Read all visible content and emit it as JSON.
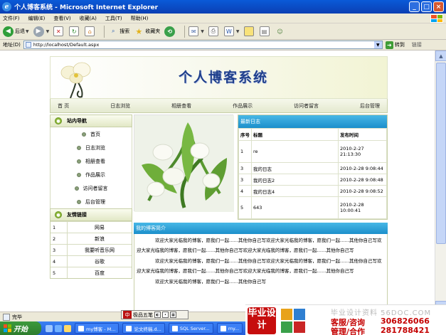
{
  "window": {
    "title": "个人博客系统 - Microsoft Internet Explorer",
    "controls": [
      "_",
      "□",
      "×"
    ]
  },
  "menubar": {
    "items": [
      "文件(F)",
      "编辑(E)",
      "查看(V)",
      "收藏(A)",
      "工具(T)",
      "帮助(H)"
    ]
  },
  "toolbar": {
    "back": "后退",
    "search": "搜索",
    "favorites": "收藏夹"
  },
  "address": {
    "label": "地址(D)",
    "url": "http://localhost/Default.aspx",
    "go": "转到",
    "links": "链接"
  },
  "site": {
    "title": "个人博客系统",
    "nav": [
      "首 页",
      "日志浏览",
      "相册查看",
      "作品展示",
      "访问者留言",
      "后台管理"
    ],
    "sidebar": {
      "nav_title": "站内导航",
      "nav_items": [
        "首页",
        "日志浏览",
        "相册查看",
        "作品展示",
        "访问者留言",
        "后台管理"
      ],
      "links_title": "友情链接",
      "links": [
        {
          "num": "1",
          "name": "网易"
        },
        {
          "num": "2",
          "name": "新浪"
        },
        {
          "num": "3",
          "name": "我要听音乐网"
        },
        {
          "num": "4",
          "name": "谷歌"
        },
        {
          "num": "5",
          "name": "百度"
        }
      ]
    },
    "diary": {
      "title": "最新日志",
      "headers": {
        "num": "序号",
        "title": "标题",
        "time": "发布时间"
      },
      "rows": [
        {
          "num": "1",
          "title": "re",
          "time": "2010-2-27 21:13:30"
        },
        {
          "num": "3",
          "title": "我的日志",
          "time": "2010-2-28 9:08:44"
        },
        {
          "num": "3",
          "title": "我的日志2",
          "time": "2010-2-28 9:08:48"
        },
        {
          "num": "4",
          "title": "我的日志4",
          "time": "2010-2-28 9:08:52"
        },
        {
          "num": "5",
          "title": "643",
          "time": "2010-2-28 10:00:41"
        }
      ]
    },
    "intro": {
      "title": "我的博客简介",
      "paragraphs": [
        "欢迎大家光临我的博客，愿我们一起……其他你自己写欢迎大家光临我的博客，愿我们一起……其他你自己写欢迎大家光临我的博客，愿我们一起……其他你自己写欢迎大家光临我的博客，愿我们一起……其他你自己写",
        "欢迎大家光临我的博客，愿我们一起……其他你自己写欢迎大家光临我的博客，愿我们一起……其他你自己写欢迎大家光临我的博客，愿我们一起……其他你自己写欢迎大家光临我的博客，愿我们一起……其他你自己写",
        "欢迎大家光临我的博客，愿我们一起……其他你自己写"
      ]
    }
  },
  "status": {
    "text": "完毕",
    "ime": "极品五笔"
  },
  "taskbar": {
    "start": "开始",
    "tasks": [
      "my博客 - M...",
      "论文终稿.d...",
      "SQL Server...",
      "my..."
    ]
  },
  "ad": {
    "logo_text": "毕业设计",
    "watermark": "毕业设计资料 56DOC.COM",
    "label1": "客服/咨询",
    "phone1": "306826066",
    "label2": "管理/合作",
    "phone2": "281788421"
  },
  "colors": {
    "accent": "#1c8fcb",
    "title_blue": "#1f3f8c",
    "xp_blue": "#245edb"
  }
}
